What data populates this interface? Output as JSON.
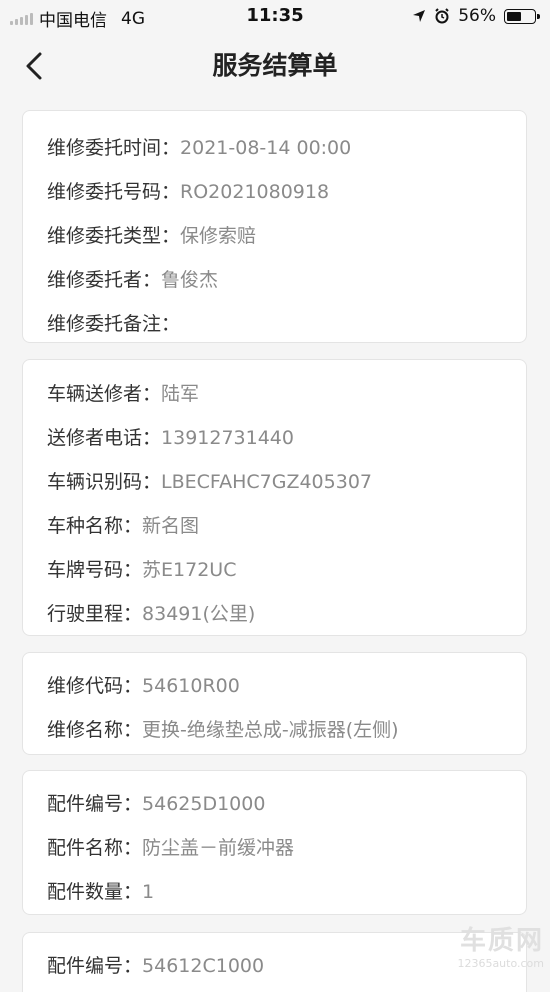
{
  "status_bar": {
    "carrier": "中国电信",
    "network": "4G",
    "time": "11:35",
    "battery": "56%",
    "battery_level": 0.56
  },
  "nav": {
    "title": "服务结算单"
  },
  "cards": [
    [
      {
        "label": "维修委托时间：",
        "value": "2021-08-14 00:00"
      },
      {
        "label": "维修委托号码：",
        "value": "RO2021080918"
      },
      {
        "label": "维修委托类型：",
        "value": "保修索赔"
      },
      {
        "label": "维修委托者：",
        "value": "鲁俊杰"
      },
      {
        "label": "维修委托备注：",
        "value": ""
      }
    ],
    [
      {
        "label": "车辆送修者：",
        "value": "陆军"
      },
      {
        "label": "送修者电话：",
        "value": "13912731440"
      },
      {
        "label": "车辆识别码：",
        "value": "LBECFAHC7GZ405307"
      },
      {
        "label": "车种名称：",
        "value": "新名图"
      },
      {
        "label": "车牌号码：",
        "value": "苏E172UC"
      },
      {
        "label": "行驶里程：",
        "value": "83491(公里)"
      }
    ],
    [
      {
        "label": "维修代码：",
        "value": "54610R00"
      },
      {
        "label": "维修名称：",
        "value": "更换-绝缘垫总成-减振器(左侧)"
      }
    ],
    [
      {
        "label": "配件编号：",
        "value": "54625D1000"
      },
      {
        "label": "配件名称：",
        "value": "防尘盖－前缓冲器"
      },
      {
        "label": "配件数量：",
        "value": "1"
      }
    ],
    [
      {
        "label": "配件编号：",
        "value": "54612C1000"
      }
    ]
  ],
  "watermark": {
    "brand": "车质网",
    "site": "12365auto.com"
  }
}
